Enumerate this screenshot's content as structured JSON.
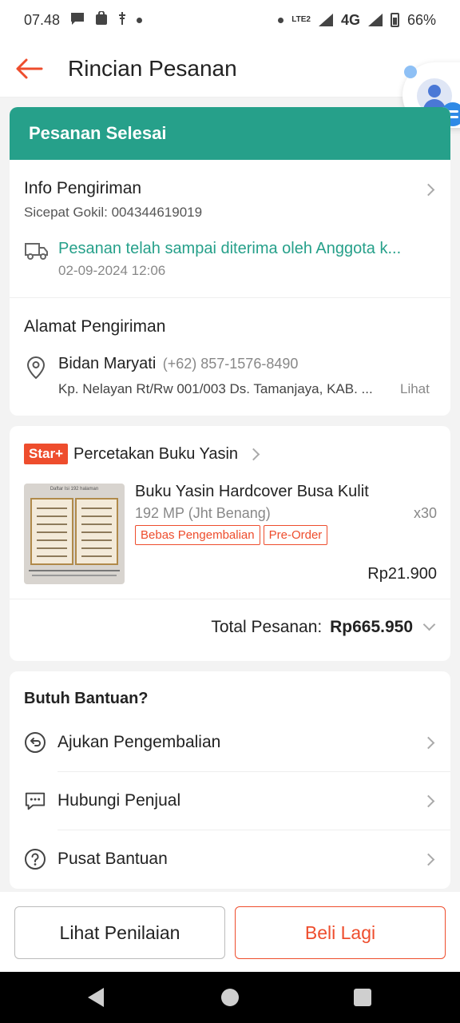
{
  "status_bar": {
    "time": "07.48",
    "network": "4G",
    "lte_label": "LTE2",
    "battery": "66%"
  },
  "header": {
    "title": "Rincian Pesanan"
  },
  "status": {
    "banner": "Pesanan Selesai"
  },
  "shipping": {
    "title": "Info Pengiriman",
    "courier": "Sicepat Gokil: 004344619019",
    "tracking_message": "Pesanan telah sampai diterima oleh Anggota k...",
    "tracking_time": "02-09-2024 12:06"
  },
  "address": {
    "title": "Alamat Pengiriman",
    "name": "Bidan Maryati",
    "phone": "(+62) 857-1576-8490",
    "line": "Kp. Nelayan Rt/Rw 001/003 Ds. Tamanjaya, KAB. ...",
    "more_label": "Lihat"
  },
  "order": {
    "shop_badge": "Star+",
    "shop_name": "Percetakan Buku Yasin",
    "product_name": "Buku Yasin Hardcover Busa Kulit",
    "variant": "192 MP (Jht Benang)",
    "quantity": "x30",
    "tags": [
      "Bebas Pengembalian",
      "Pre-Order"
    ],
    "price": "Rp21.900",
    "total_label": "Total Pesanan:",
    "total_value": "Rp665.950",
    "thumb_title": "Daftar Isi 192 halaman"
  },
  "help": {
    "title": "Butuh Bantuan?",
    "items": [
      {
        "label": "Ajukan Pengembalian",
        "icon": "return-icon"
      },
      {
        "label": "Hubungi Penjual",
        "icon": "chat-icon"
      },
      {
        "label": "Pusat Bantuan",
        "icon": "help-icon"
      }
    ]
  },
  "actions": {
    "review_label": "Lihat Penilaian",
    "buy_again_label": "Beli Lagi"
  },
  "colors": {
    "accent": "#ee4d2d",
    "status_green": "#26a08a"
  }
}
